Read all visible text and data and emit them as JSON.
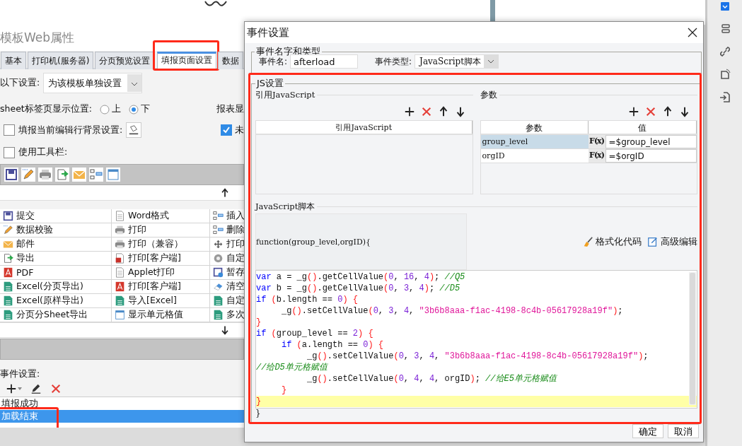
{
  "left_window": {
    "title": "模板Web属性",
    "tabs": [
      {
        "label": "基本",
        "selected": false
      },
      {
        "label": "打印机(服务器)",
        "selected": false
      },
      {
        "label": "分页预览设置",
        "selected": false
      },
      {
        "label": "填报页面设置",
        "selected": true,
        "highlighted": true
      },
      {
        "label": "数据",
        "selected": false
      }
    ],
    "scope": {
      "label": "以下设置:",
      "value": "为该模板单独设置"
    },
    "sheet_position": {
      "label": "sheet标签页显示位置:",
      "options": [
        {
          "label": "上",
          "selected": false
        },
        {
          "label": "下",
          "selected": true
        }
      ]
    },
    "report_label": "报表显",
    "edit_row_background": {
      "label": "填报当前编辑行背景设置:",
      "checked": false
    },
    "side_checkbox": {
      "label": "未",
      "checked": true
    },
    "use_toolbar": {
      "label": "使用工具栏:",
      "checked": false
    },
    "button_rows": [
      [
        "提交",
        "Word格式",
        "插入"
      ],
      [
        "数据校验",
        "打印",
        "删除"
      ],
      [
        "邮件",
        "打印（兼容）",
        "打印"
      ],
      [
        "导出",
        "打印[客户端]",
        "自定"
      ],
      [
        "PDF",
        "Applet打印",
        "暂存"
      ],
      [
        "Excel(分页导出)",
        "打印[客户端]",
        "清空"
      ],
      [
        "Excel(原样导出)",
        "导入[Excel]",
        "自定"
      ],
      [
        "分页分Sheet导出",
        "显示单元格值",
        "多次"
      ]
    ],
    "events": {
      "label": "事件设置:",
      "items": [
        {
          "label": "填报成功",
          "selected": false,
          "highlighted": false
        },
        {
          "label": "加载结束",
          "selected": true,
          "highlighted": true
        }
      ]
    }
  },
  "dialog": {
    "title": "事件设置",
    "name_group": {
      "legend": "事件名字和类型",
      "name_label": "事件名:",
      "name_value": "afterload",
      "type_label": "事件类型:",
      "type_value": "JavaScript脚本"
    },
    "js_group": {
      "legend": "JS设置",
      "highlighted": true,
      "ref_section": {
        "title": "引用JavaScript",
        "column": "引用JavaScript"
      },
      "param_section": {
        "title": "参数",
        "columns": [
          "参数",
          "值"
        ],
        "rows": [
          {
            "name": "group_level",
            "formula": "F(x)",
            "value": "=$group_level",
            "selected": true
          },
          {
            "name": "orgID",
            "formula": "F(x)",
            "value": "=$orgID",
            "selected": false
          }
        ]
      },
      "script_label": "JavaScript脚本",
      "function_header": "function(group_level,orgID){",
      "format_button": "格式化代码",
      "advanced_button": "高级编辑",
      "code_lines": [
        {
          "current": false,
          "tokens": [
            {
              "kind": "keyword",
              "text": "var"
            },
            {
              "kind": "plain",
              "text": " a = _g"
            },
            {
              "kind": "bracket",
              "text": "()"
            },
            {
              "kind": "plain",
              "text": ".getCellValue"
            },
            {
              "kind": "bracket",
              "text": "("
            },
            {
              "kind": "number",
              "text": "0"
            },
            {
              "kind": "plain",
              "text": ", "
            },
            {
              "kind": "number",
              "text": "16"
            },
            {
              "kind": "plain",
              "text": ", "
            },
            {
              "kind": "number",
              "text": "4"
            },
            {
              "kind": "bracket",
              "text": ")"
            },
            {
              "kind": "plain",
              "text": "; "
            },
            {
              "kind": "comment",
              "text": "//Q5"
            }
          ]
        },
        {
          "current": false,
          "tokens": [
            {
              "kind": "keyword",
              "text": "var"
            },
            {
              "kind": "plain",
              "text": " b = _g"
            },
            {
              "kind": "bracket",
              "text": "()"
            },
            {
              "kind": "plain",
              "text": ".getCellValue"
            },
            {
              "kind": "bracket",
              "text": "("
            },
            {
              "kind": "number",
              "text": "0"
            },
            {
              "kind": "plain",
              "text": ", "
            },
            {
              "kind": "number",
              "text": "3"
            },
            {
              "kind": "plain",
              "text": ", "
            },
            {
              "kind": "number",
              "text": "4"
            },
            {
              "kind": "bracket",
              "text": ")"
            },
            {
              "kind": "plain",
              "text": "; "
            },
            {
              "kind": "comment",
              "text": "//D5"
            }
          ]
        },
        {
          "current": false,
          "tokens": [
            {
              "kind": "keyword",
              "text": "if"
            },
            {
              "kind": "bracket",
              "text": " ("
            },
            {
              "kind": "plain",
              "text": "b.length == "
            },
            {
              "kind": "number",
              "text": "0"
            },
            {
              "kind": "bracket",
              "text": ") {"
            }
          ]
        },
        {
          "current": false,
          "tokens": [
            {
              "kind": "plain",
              "text": "     _g"
            },
            {
              "kind": "bracket",
              "text": "()"
            },
            {
              "kind": "plain",
              "text": ".setCellValue"
            },
            {
              "kind": "bracket",
              "text": "("
            },
            {
              "kind": "number",
              "text": "0"
            },
            {
              "kind": "plain",
              "text": ", "
            },
            {
              "kind": "number",
              "text": "3"
            },
            {
              "kind": "plain",
              "text": ", "
            },
            {
              "kind": "number",
              "text": "4"
            },
            {
              "kind": "plain",
              "text": ", "
            },
            {
              "kind": "string",
              "text": "\"3b6b8aaa-f1ac-4198-8c4b-05617928a19f\""
            },
            {
              "kind": "bracket",
              "text": ")"
            },
            {
              "kind": "plain",
              "text": ";"
            }
          ]
        },
        {
          "current": false,
          "tokens": [
            {
              "kind": "bracket",
              "text": "}"
            }
          ]
        },
        {
          "current": false,
          "tokens": [
            {
              "kind": "keyword",
              "text": "if"
            },
            {
              "kind": "bracket",
              "text": " ("
            },
            {
              "kind": "plain",
              "text": "group_level == "
            },
            {
              "kind": "number",
              "text": "2"
            },
            {
              "kind": "bracket",
              "text": ") {"
            }
          ]
        },
        {
          "current": false,
          "tokens": [
            {
              "kind": "keyword",
              "text": "     if"
            },
            {
              "kind": "bracket",
              "text": " ("
            },
            {
              "kind": "plain",
              "text": "a.length == "
            },
            {
              "kind": "number",
              "text": "0"
            },
            {
              "kind": "bracket",
              "text": ") {"
            }
          ]
        },
        {
          "current": false,
          "tokens": [
            {
              "kind": "plain",
              "text": "          _g"
            },
            {
              "kind": "bracket",
              "text": "()"
            },
            {
              "kind": "plain",
              "text": ".setCellValue"
            },
            {
              "kind": "bracket",
              "text": "("
            },
            {
              "kind": "number",
              "text": "0"
            },
            {
              "kind": "plain",
              "text": ", "
            },
            {
              "kind": "number",
              "text": "3"
            },
            {
              "kind": "plain",
              "text": ", "
            },
            {
              "kind": "number",
              "text": "4"
            },
            {
              "kind": "plain",
              "text": ", "
            },
            {
              "kind": "string",
              "text": "\"3b6b8aaa-f1ac-4198-8c4b-05617928a19f\""
            },
            {
              "kind": "bracket",
              "text": ")"
            },
            {
              "kind": "plain",
              "text": ";"
            }
          ]
        },
        {
          "current": false,
          "tokens": [
            {
              "kind": "comment",
              "text": "//给D5单元格赋值"
            }
          ]
        },
        {
          "current": false,
          "tokens": [
            {
              "kind": "plain",
              "text": "          _g"
            },
            {
              "kind": "bracket",
              "text": "()"
            },
            {
              "kind": "plain",
              "text": ".setCellValue"
            },
            {
              "kind": "bracket",
              "text": "("
            },
            {
              "kind": "number",
              "text": "0"
            },
            {
              "kind": "plain",
              "text": ", "
            },
            {
              "kind": "number",
              "text": "4"
            },
            {
              "kind": "plain",
              "text": ", "
            },
            {
              "kind": "number",
              "text": "4"
            },
            {
              "kind": "plain",
              "text": ", orgID"
            },
            {
              "kind": "bracket",
              "text": ")"
            },
            {
              "kind": "plain",
              "text": "; "
            },
            {
              "kind": "comment",
              "text": "//给E5单元格赋值"
            }
          ]
        },
        {
          "current": false,
          "tokens": [
            {
              "kind": "bracket",
              "text": "     }"
            }
          ]
        },
        {
          "current": true,
          "tokens": [
            {
              "kind": "bracket",
              "text": "}"
            }
          ]
        }
      ],
      "function_footer": "}"
    },
    "buttons": [
      "确定",
      "取消"
    ]
  }
}
